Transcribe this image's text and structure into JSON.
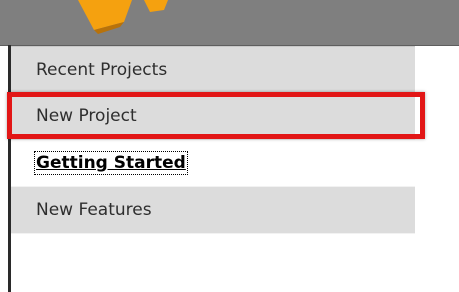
{
  "sidebar": {
    "items": [
      {
        "label": "Recent Projects"
      },
      {
        "label": "New Project"
      },
      {
        "label": "Getting Started"
      },
      {
        "label": "New Features"
      }
    ]
  },
  "colors": {
    "header": "#7f7f7f",
    "item_bg": "#dcdcdc",
    "highlight": "#e21616",
    "logo": "#f5a10f"
  },
  "icons": {
    "logo": "app-logo-icon"
  }
}
